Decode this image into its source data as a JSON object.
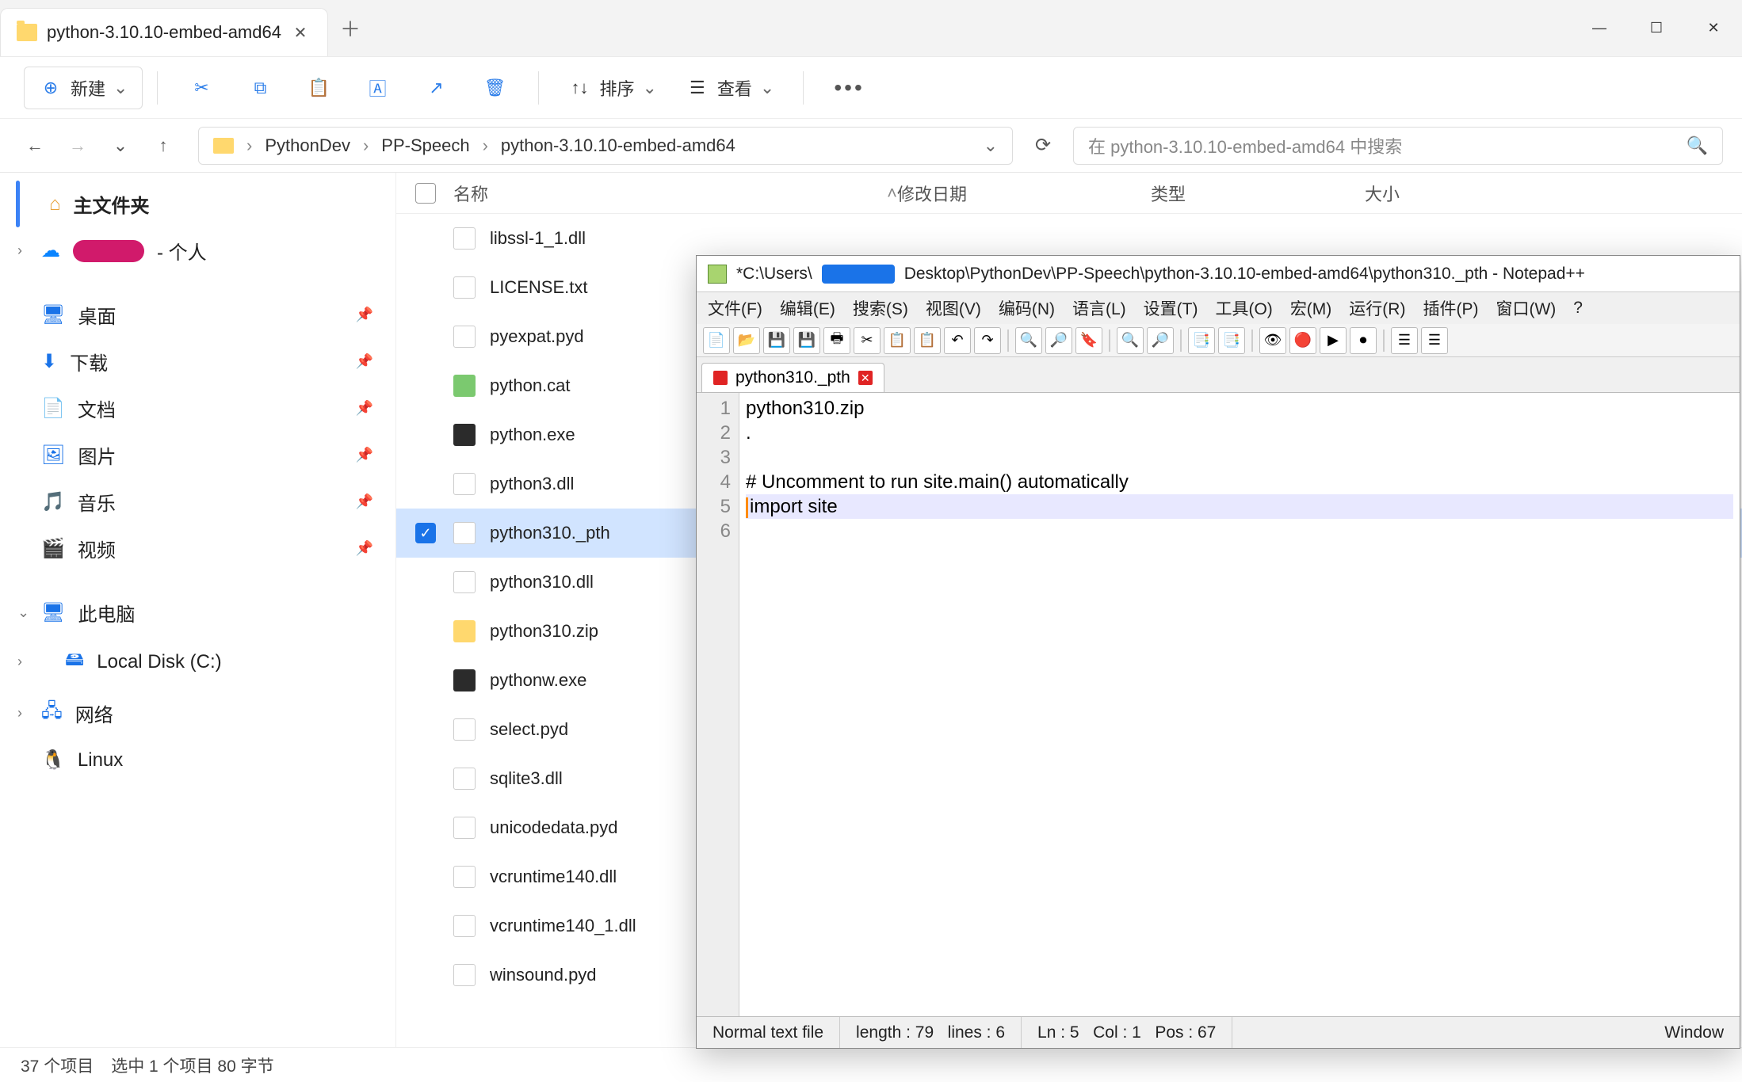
{
  "explorer": {
    "tab_title": "python-3.10.10-embed-amd64",
    "new_label": "新建",
    "sort_label": "排序",
    "view_label": "查看",
    "breadcrumb": [
      "PythonDev",
      "PP-Speech",
      "python-3.10.10-embed-amd64"
    ],
    "search_placeholder": "在 python-3.10.10-embed-amd64 中搜索",
    "columns": {
      "name": "名称",
      "date": "修改日期",
      "type": "类型",
      "size": "大小"
    },
    "sidebar": {
      "home": "主文件夹",
      "personal": "- 个人",
      "quick": [
        {
          "icon": "desktop",
          "label": "桌面"
        },
        {
          "icon": "download",
          "label": "下载"
        },
        {
          "icon": "document",
          "label": "文档"
        },
        {
          "icon": "picture",
          "label": "图片"
        },
        {
          "icon": "music",
          "label": "音乐"
        },
        {
          "icon": "video",
          "label": "视频"
        }
      ],
      "thispc": "此电脑",
      "localdisk": "Local Disk (C:)",
      "network": "网络",
      "linux": "Linux"
    },
    "files": [
      {
        "name": "libssl-1_1.dll",
        "kind": "dll"
      },
      {
        "name": "LICENSE.txt",
        "kind": "txt"
      },
      {
        "name": "pyexpat.pyd",
        "kind": "pyd"
      },
      {
        "name": "python.cat",
        "kind": "cat"
      },
      {
        "name": "python.exe",
        "kind": "exe"
      },
      {
        "name": "python3.dll",
        "kind": "dll"
      },
      {
        "name": "python310._pth",
        "kind": "file",
        "selected": true
      },
      {
        "name": "python310.dll",
        "kind": "dll"
      },
      {
        "name": "python310.zip",
        "kind": "zip"
      },
      {
        "name": "pythonw.exe",
        "kind": "exe"
      },
      {
        "name": "select.pyd",
        "kind": "pyd"
      },
      {
        "name": "sqlite3.dll",
        "kind": "dll"
      },
      {
        "name": "unicodedata.pyd",
        "kind": "pyd"
      },
      {
        "name": "vcruntime140.dll",
        "kind": "dll"
      },
      {
        "name": "vcruntime140_1.dll",
        "kind": "dll"
      },
      {
        "name": "winsound.pyd",
        "kind": "pyd"
      }
    ],
    "status": {
      "items": "37 个项目",
      "selected": "选中 1 个项目  80 字节"
    }
  },
  "npp": {
    "title_prefix": "*C:\\Users\\",
    "title_suffix": "Desktop\\PythonDev\\PP-Speech\\python-3.10.10-embed-amd64\\python310._pth - Notepad++",
    "menu": [
      "文件(F)",
      "编辑(E)",
      "搜索(S)",
      "视图(V)",
      "编码(N)",
      "语言(L)",
      "设置(T)",
      "工具(O)",
      "宏(M)",
      "运行(R)",
      "插件(P)",
      "窗口(W)",
      "?"
    ],
    "tab": "python310._pth",
    "lines": [
      "python310.zip",
      ".",
      "",
      "# Uncomment to run site.main() automatically",
      "import site",
      ""
    ],
    "gutter": [
      "1",
      "2",
      "3",
      "4",
      "5",
      "6"
    ],
    "status": {
      "mode": "Normal text file",
      "length": "length : 79",
      "lines": "lines : 6",
      "ln": "Ln : 5",
      "col": "Col : 1",
      "pos": "Pos : 67",
      "enc": "Window"
    }
  }
}
